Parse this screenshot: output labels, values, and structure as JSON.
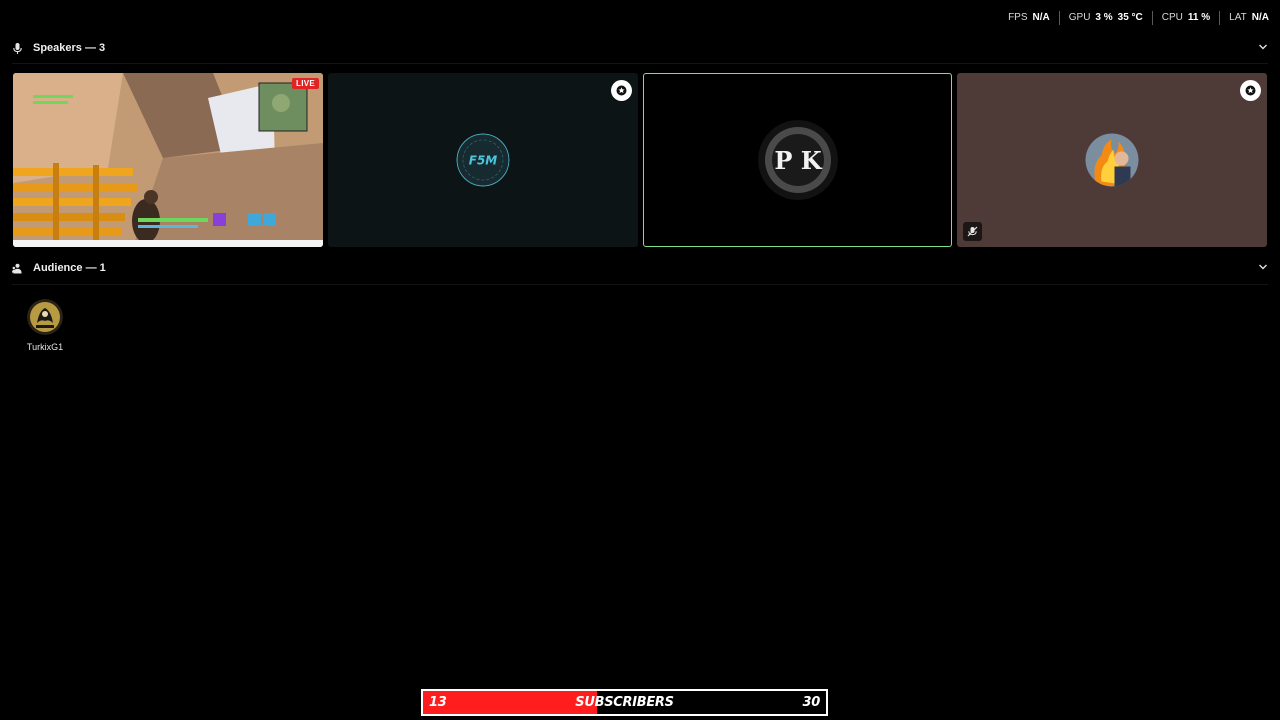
{
  "perf": [
    {
      "label": "FPS",
      "value": "N/A"
    },
    {
      "label": "GPU",
      "value": "3 %",
      "extra": "35 °C"
    },
    {
      "label": "CPU",
      "value": "11 %"
    },
    {
      "label": "LAT",
      "value": "N/A"
    }
  ],
  "speakers": {
    "label": "Speakers — 3",
    "icon": "microphone-icon",
    "tiles": [
      {
        "kind": "screen-share",
        "badge": "LIVE"
      },
      {
        "kind": "avatar",
        "avatar_text": "F5M",
        "badge_icon": "moderator-icon"
      },
      {
        "kind": "avatar",
        "avatar_text": "P K",
        "active_speaker": true
      },
      {
        "kind": "avatar",
        "badge_icon": "moderator-icon",
        "muted_icon": "mic-muted-icon"
      }
    ]
  },
  "audience": {
    "label": "Audience — 1",
    "icon": "audience-icon",
    "members": [
      {
        "name": "TurkixG1"
      }
    ]
  },
  "subscriber_goal": {
    "current": "13",
    "label": "SUBSCRIBERS",
    "target": "30",
    "progress": 0.433,
    "fill_color": "#ff1d1d"
  },
  "colors": {
    "active_speaker_border": "#7fe08a",
    "live_badge": "#e02424"
  }
}
